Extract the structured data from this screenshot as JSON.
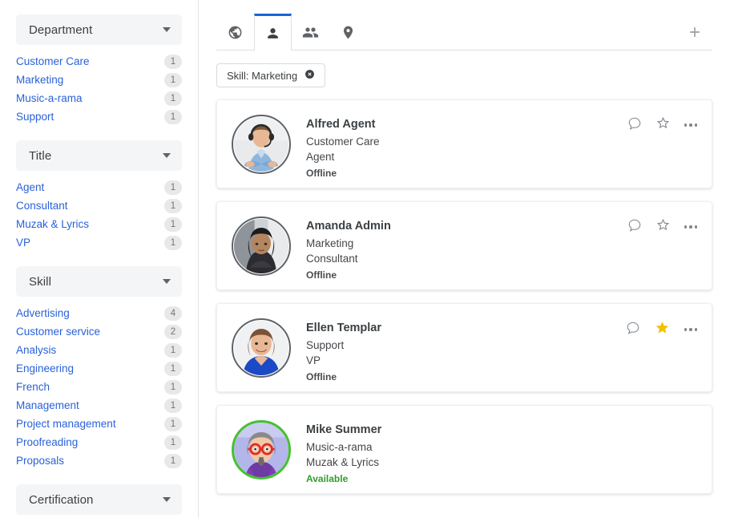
{
  "sidebar": {
    "facets": [
      {
        "title": "Department",
        "caret": "chevron-down-icon",
        "items": [
          {
            "label": "Customer Care",
            "count": "1"
          },
          {
            "label": "Marketing",
            "count": "1"
          },
          {
            "label": "Music-a-rama",
            "count": "1"
          },
          {
            "label": "Support",
            "count": "1"
          }
        ]
      },
      {
        "title": "Title",
        "caret": "chevron-down-icon",
        "items": [
          {
            "label": "Agent",
            "count": "1"
          },
          {
            "label": "Consultant",
            "count": "1"
          },
          {
            "label": "Muzak & Lyrics",
            "count": "1"
          },
          {
            "label": "VP",
            "count": "1"
          }
        ]
      },
      {
        "title": "Skill",
        "caret": "chevron-down-icon",
        "items": [
          {
            "label": "Advertising",
            "count": "4"
          },
          {
            "label": "Customer service",
            "count": "2"
          },
          {
            "label": "Analysis",
            "count": "1"
          },
          {
            "label": "Engineering",
            "count": "1"
          },
          {
            "label": "French",
            "count": "1"
          },
          {
            "label": "Management",
            "count": "1"
          },
          {
            "label": "Project management",
            "count": "1"
          },
          {
            "label": "Proofreading",
            "count": "1"
          },
          {
            "label": "Proposals",
            "count": "1"
          }
        ]
      },
      {
        "title": "Certification",
        "caret": "chevron-down-icon",
        "items": []
      }
    ]
  },
  "tabs": [
    {
      "name": "globe-icon",
      "active": false
    },
    {
      "name": "person-icon",
      "active": true
    },
    {
      "name": "people-icon",
      "active": false
    },
    {
      "name": "location-pin-icon",
      "active": false
    }
  ],
  "add_tab": {
    "icon": "plus-icon",
    "label": "+"
  },
  "filters": [
    {
      "label": "Skill: Marketing",
      "remove_icon": "close-circle-icon"
    }
  ],
  "cards": [
    {
      "name": "Alfred Agent",
      "department": "Customer Care",
      "title": "Agent",
      "status": "Offline",
      "status_available": false,
      "avatar": "photo-man-headset",
      "ring": "gray",
      "favorited": false,
      "actions": {
        "chat": "chat-bubble-icon",
        "star": "star-icon",
        "more": "more-options-icon"
      },
      "show_actions": true
    },
    {
      "name": "Amanda Admin",
      "department": "Marketing",
      "title": "Consultant",
      "status": "Offline",
      "status_available": false,
      "avatar": "photo-woman-dark-hair",
      "ring": "gray",
      "favorited": false,
      "actions": {
        "chat": "chat-bubble-icon",
        "star": "star-icon",
        "more": "more-options-icon"
      },
      "show_actions": true
    },
    {
      "name": "Ellen Templar",
      "department": "Support",
      "title": "VP",
      "status": "Offline",
      "status_available": false,
      "avatar": "photo-woman-blue-top",
      "ring": "gray",
      "favorited": true,
      "actions": {
        "chat": "chat-bubble-icon",
        "star": "star-filled-icon",
        "more": "more-options-icon"
      },
      "show_actions": true
    },
    {
      "name": "Mike Summer",
      "department": "Music-a-rama",
      "title": "Muzak & Lyrics",
      "status": "Available",
      "status_available": true,
      "avatar": "cartoon-man-red-glasses",
      "ring": "green",
      "favorited": false,
      "actions": {
        "chat": "chat-bubble-icon",
        "star": "star-icon",
        "more": "more-options-icon"
      },
      "show_actions": false
    }
  ],
  "colors": {
    "link": "#2962d9",
    "accent": "#1a65d6",
    "available": "#2f9e28",
    "star_filled": "#f2c200",
    "badge_bg": "#e8e8e8",
    "facet_header_bg": "#f4f5f6"
  }
}
